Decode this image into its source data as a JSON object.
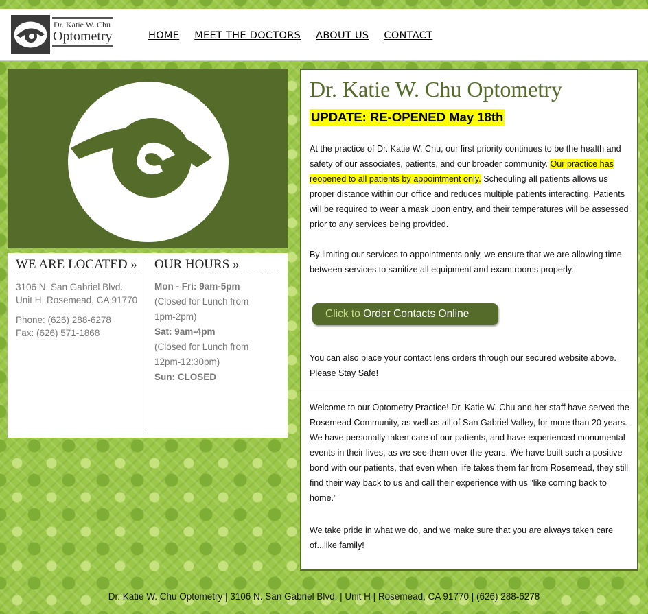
{
  "logo": {
    "line1": "Dr. Katie W. Chu",
    "line2": "Optometry"
  },
  "nav": {
    "home": "HOME",
    "doctors": "MEET THE DOCTORS",
    "about": "ABOUT US",
    "contact": "CONTACT"
  },
  "location": {
    "heading": "WE ARE LOCATED »",
    "address1": "3106 N. San Gabriel Blvd.",
    "address2": "Unit H, Rosemead, CA 91770",
    "phone": "Phone: (626) 288-6278",
    "fax": "Fax: (626) 571-1868"
  },
  "hours": {
    "heading": "OUR HOURS »",
    "weekday_label": "Mon - Fri:",
    "weekday_time": "9am-5pm",
    "weekday_lunch_1": "(Closed for Lunch from",
    "weekday_lunch_2": "1pm-2pm)",
    "sat_label": "Sat:",
    "sat_time": "9am-4pm",
    "sat_lunch_1": "(Closed for Lunch from",
    "sat_lunch_2": "12pm-12:30pm)",
    "sun_label": "Sun:",
    "sun_time": "CLOSED"
  },
  "main": {
    "title": "Dr. Katie W. Chu Optometry",
    "update": "UPDATE: RE-OPENED May 18th",
    "p1_a": "At the practice of Dr. Katie W. Chu, our first priority continues to be the health and safety of our associates, patients, and our broader community. ",
    "p1_hl": "Our practice has reopened to all patients by appointment only.",
    "p1_b": " Scheduling all patients allows us proper distance within our office and reduces multiple patients interacting. Patients will be required to wear a mask upon entry, and their temperatures will be assessed prior to any services being provided.",
    "p2": "By limiting our services to appointments only, we ensure that we are allowing time between services to sanitize all equipment and exam rooms properly.",
    "order_lead": "Click to",
    "order_rest": "Order Contacts Online",
    "p3": "You can also place your contact lens orders through our secured website above. Please Stay Safe!",
    "p4": "Welcome to our Optometry Practice! Dr. Katie W. Chu and her staff have served the Rosemead Community, as well as all of San Gabriel Valley, for more than 20 years. We have personally taken care of our patients, and have experienced monumental events in their lives, as we see them over the years. We have built such a positive bond with our patients, that even when life takes them far from Rosemead, they still find their way back to us and call their experience with us \"like coming back to home.\"",
    "p5": "We take pride in what we do, and we make sure that you are always taken care of...like family!"
  },
  "footer": {
    "text": "Dr. Katie W. Chu Optometry | 3106 N. San Gabriel Blvd. | Unit H | Rosemead, CA 91770 | (626) 288-6278"
  }
}
